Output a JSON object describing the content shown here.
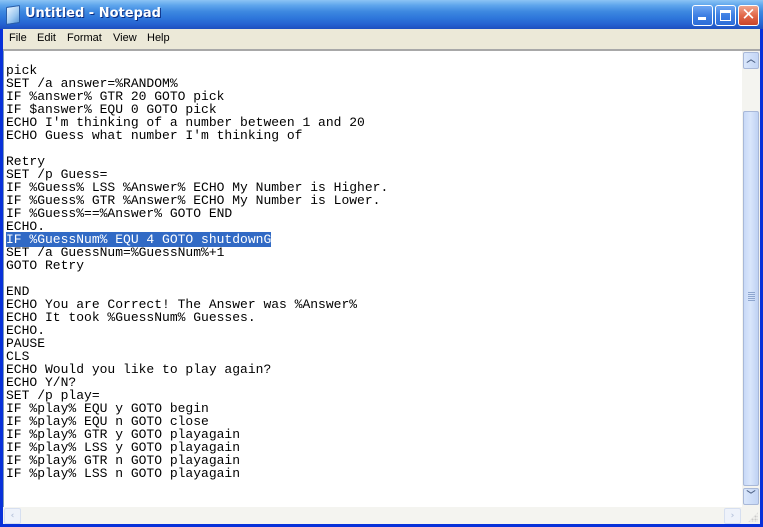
{
  "window": {
    "title": "Untitled - Notepad",
    "icon": "notepad-icon",
    "controls": {
      "minimize": "minimize-icon",
      "maximize": "maximize-icon",
      "close": "close-icon"
    },
    "colors": {
      "titlebar": "#2f78db",
      "close_button": "#e2694a",
      "selection": "#316ac5",
      "menubar": "#ece9d8"
    }
  },
  "menubar": {
    "items": [
      {
        "label": "File"
      },
      {
        "label": "Edit"
      },
      {
        "label": "Format"
      },
      {
        "label": "View"
      },
      {
        "label": "Help"
      }
    ]
  },
  "editor": {
    "lines": [
      "pick",
      "SET /a answer=%RANDOM%",
      "IF %answer% GTR 20 GOTO pick",
      "IF $answer% EQU 0 GOTO pick",
      "ECHO I'm thinking of a number between 1 and 20",
      "ECHO Guess what number I'm thinking of",
      "",
      "Retry",
      "SET /p Guess=",
      "IF %Guess% LSS %Answer% ECHO My Number is Higher.",
      "IF %Guess% GTR %Answer% ECHO My Number is Lower.",
      "IF %Guess%==%Answer% GOTO END",
      "ECHO.",
      "IF %GuessNum% EQU 4 GOTO shutdownG",
      "SET /a GuessNum=%GuessNum%+1",
      "GOTO Retry",
      "",
      "END",
      "ECHO You are Correct! The Answer was %Answer%",
      "ECHO It took %GuessNum% Guesses.",
      "ECHO.",
      "PAUSE",
      "CLS",
      "ECHO Would you like to play again?",
      "ECHO Y/N?",
      "SET /p play=",
      "IF %play% EQU y GOTO begin",
      "IF %play% EQU n GOTO close",
      "IF %play% GTR y GOTO playagain",
      "IF %play% LSS y GOTO playagain",
      "IF %play% GTR n GOTO playagain",
      "IF %play% LSS n GOTO playagain"
    ],
    "selected_line_index": 13
  },
  "scrollbars": {
    "vertical": {
      "up_icon": "chevron-up-icon",
      "down_icon": "chevron-down-icon",
      "position": "bottom"
    },
    "horizontal": {
      "left_icon": "chevron-left-icon",
      "right_icon": "chevron-right-icon"
    }
  }
}
